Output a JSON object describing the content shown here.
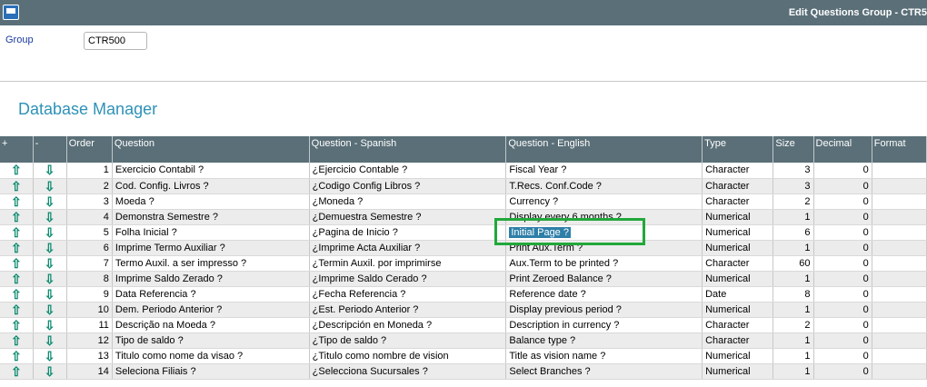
{
  "window": {
    "title": "Edit Questions Group - CTR5"
  },
  "group": {
    "label": "Group",
    "value": "CTR500"
  },
  "section": {
    "title": "Database Manager"
  },
  "table": {
    "headers": [
      "+",
      "-",
      "Order",
      "Question",
      "Question - Spanish",
      "Question - English",
      "Type",
      "Size",
      "Decimal",
      "Format"
    ],
    "rows": [
      {
        "order": "1",
        "question": "Exercicio Contabil ?",
        "spanish": "¿Ejercicio Contable ?",
        "english": "Fiscal Year ?",
        "type": "Character",
        "size": "3",
        "decimal": "0",
        "format": ""
      },
      {
        "order": "2",
        "question": "Cod. Config. Livros ?",
        "spanish": "¿Codigo Config Libros ?",
        "english": "T.Recs. Conf.Code ?",
        "type": "Character",
        "size": "3",
        "decimal": "0",
        "format": ""
      },
      {
        "order": "3",
        "question": "Moeda ?",
        "spanish": "¿Moneda ?",
        "english": "Currency ?",
        "type": "Character",
        "size": "2",
        "decimal": "0",
        "format": ""
      },
      {
        "order": "4",
        "question": "Demonstra Semestre ?",
        "spanish": "¿Demuestra Semestre ?",
        "english": "Display every 6 months ?",
        "type": "Numerical",
        "size": "1",
        "decimal": "0",
        "format": ""
      },
      {
        "order": "5",
        "question": "Folha Inicial ?",
        "spanish": "¿Pagina de Inicio ?",
        "english": "Initial Page ?",
        "type": "Numerical",
        "size": "6",
        "decimal": "0",
        "format": ""
      },
      {
        "order": "6",
        "question": "Imprime Termo Auxiliar ?",
        "spanish": "¿Imprime Acta Auxiliar ?",
        "english": "Print Aux.Term ?",
        "type": "Numerical",
        "size": "1",
        "decimal": "0",
        "format": ""
      },
      {
        "order": "7",
        "question": "Termo Auxil. a ser impresso ?",
        "spanish": "¿Termin Auxil. por imprimirse",
        "english": "Aux.Term to be printed ?",
        "type": "Character",
        "size": "60",
        "decimal": "0",
        "format": ""
      },
      {
        "order": "8",
        "question": "Imprime Saldo Zerado ?",
        "spanish": "¿Imprime Saldo Cerado ?",
        "english": "Print Zeroed Balance ?",
        "type": "Numerical",
        "size": "1",
        "decimal": "0",
        "format": ""
      },
      {
        "order": "9",
        "question": "Data Referencia ?",
        "spanish": "¿Fecha Referencia ?",
        "english": "Reference date ?",
        "type": "Date",
        "size": "8",
        "decimal": "0",
        "format": ""
      },
      {
        "order": "10",
        "question": "Dem. Periodo Anterior ?",
        "spanish": "¿Est. Periodo Anterior ?",
        "english": "Display previous period ?",
        "type": "Numerical",
        "size": "1",
        "decimal": "0",
        "format": ""
      },
      {
        "order": "11",
        "question": "Descrição na Moeda ?",
        "spanish": "¿Descripción en Moneda ?",
        "english": "Description in currency ?",
        "type": "Character",
        "size": "2",
        "decimal": "0",
        "format": ""
      },
      {
        "order": "12",
        "question": "Tipo de saldo ?",
        "spanish": "¿Tipo de saldo ?",
        "english": "Balance type ?",
        "type": "Character",
        "size": "1",
        "decimal": "0",
        "format": ""
      },
      {
        "order": "13",
        "question": "Titulo como nome da visao ?",
        "spanish": "¿Titulo como nombre de vision",
        "english": "Title as vision name ?",
        "type": "Numerical",
        "size": "1",
        "decimal": "0",
        "format": ""
      },
      {
        "order": "14",
        "question": "Seleciona Filiais ?",
        "spanish": "¿Selecciona Sucursales ?",
        "english": "Select Branches ?",
        "type": "Numerical",
        "size": "1",
        "decimal": "0",
        "format": ""
      }
    ]
  },
  "icons": {
    "move_up": "arrow-up-icon",
    "move_down": "arrow-down-icon",
    "window": "window-icon"
  },
  "colors": {
    "header_bg": "#5a6f78",
    "accent": "#2e92b8",
    "highlight": "#21a83a",
    "arrow": "#0a8a6e"
  }
}
